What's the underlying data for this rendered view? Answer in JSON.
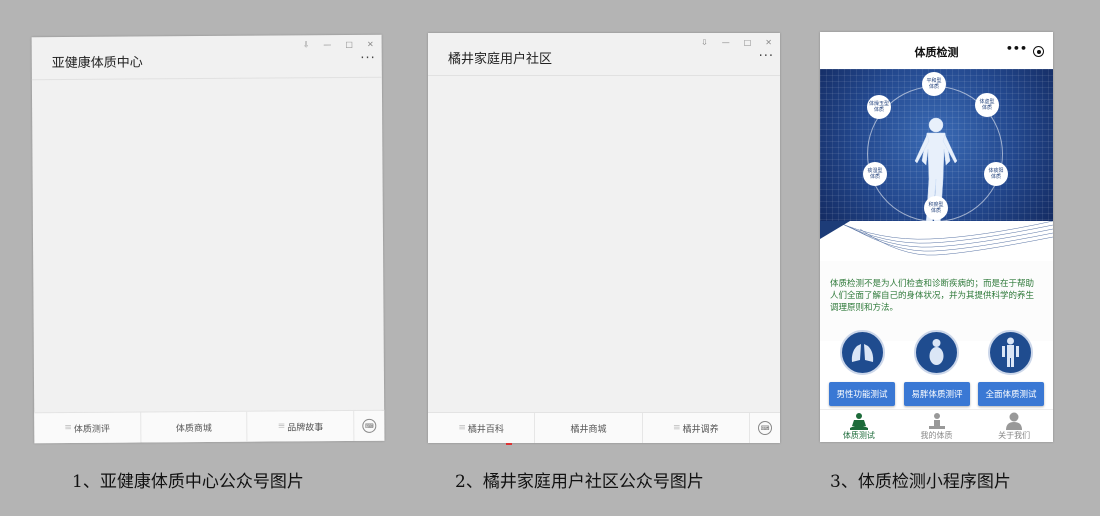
{
  "panel1": {
    "title": "亚健康体质中心",
    "more": "···",
    "window_controls": [
      "⇩",
      "—",
      "□",
      "✕"
    ],
    "menu": [
      {
        "prefix": "≡",
        "label": "体质测评"
      },
      {
        "prefix": "",
        "label": "体质商城"
      },
      {
        "prefix": "≡",
        "label": "品牌故事"
      }
    ],
    "kbd_icon": "keyboard-icon"
  },
  "panel2": {
    "title": "橘井家庭用户社区",
    "more": "···",
    "window_controls": [
      "⇩",
      "—",
      "□",
      "✕"
    ],
    "menu": [
      {
        "prefix": "≡",
        "label": "橘井百科"
      },
      {
        "prefix": "",
        "label": "橘井商城"
      },
      {
        "prefix": "≡",
        "label": "橘井调养"
      }
    ],
    "kbd_icon": "keyboard-icon"
  },
  "panel3": {
    "title": "体质检测",
    "more": "•••",
    "banner": {
      "bubbles": [
        "平和型\n体质",
        "体虚型\n体质",
        "体痰阳\n体质",
        "积瘀型\n体质",
        "痰湿型\n体质",
        "体燥玉型\n体质"
      ]
    },
    "description": "体质检测不是为人们检查和诊断疾病的；而是在于帮助人们全面了解自己的身体状况，并为其提供科学的养生调理原则和方法。",
    "buttons": [
      "男性功能测试",
      "易胖体质测评",
      "全面体质测试"
    ],
    "tabs": [
      {
        "label": "体质测试",
        "icon": "meditation-icon",
        "active": true
      },
      {
        "label": "我的体质",
        "icon": "person-sitting-icon",
        "active": false
      },
      {
        "label": "关于我们",
        "icon": "user-icon",
        "active": false
      }
    ],
    "colors": {
      "accent": "#3a78d4",
      "active_tab": "#1d6b3a",
      "description": "#2f7a3a",
      "banner": "#23488e"
    }
  },
  "captions": [
    "1、亚健康体质中心公众号图片",
    "2、橘井家庭用户社区公众号图片",
    "3、体质检测小程序图片"
  ]
}
